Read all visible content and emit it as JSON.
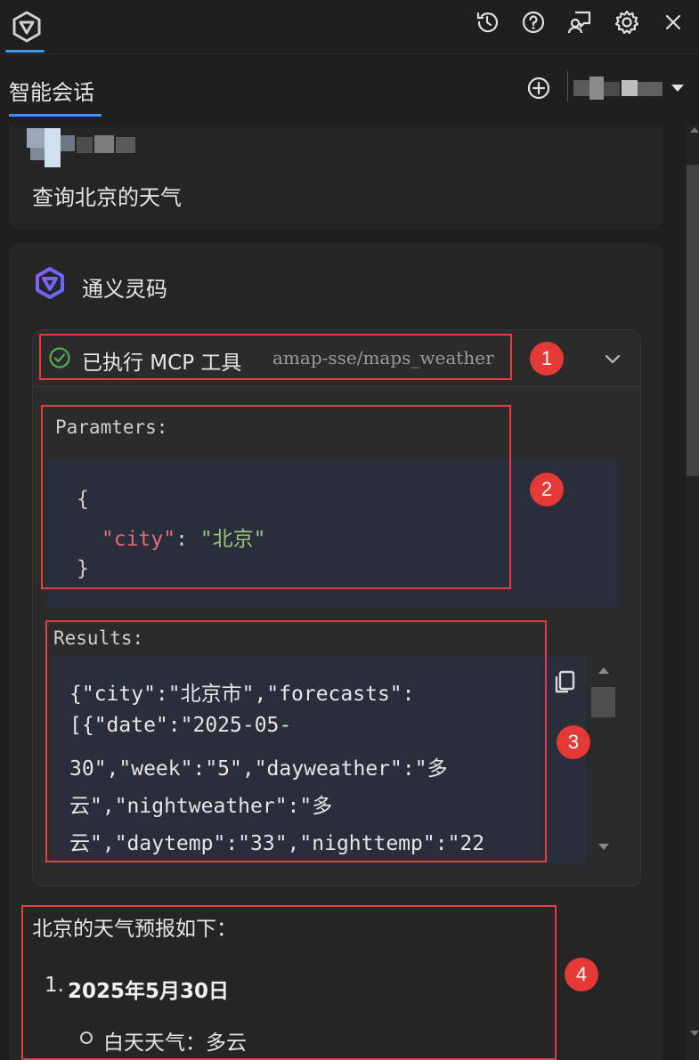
{
  "topbar": {
    "icons": [
      "history-icon",
      "help-icon",
      "feedback-icon",
      "settings-icon",
      "close-icon"
    ]
  },
  "tabs": {
    "active_label": "智能会话"
  },
  "user_message": {
    "text": "查询北京的天气"
  },
  "assistant": {
    "name": "通义灵码",
    "tool_call": {
      "status_label": "已执行 MCP 工具",
      "tool_name": "amap-sse/maps_weather",
      "params_label": "Paramters:",
      "params_open": "{",
      "params_key": "\"city\"",
      "params_colon": ": ",
      "params_value": "\"北京\"",
      "params_close": "}",
      "results_label": "Results:",
      "results_lines": [
        "{\"city\":\"北京市\",\"forecasts\":",
        "[{\"date\":\"2025-05-",
        "30\",\"week\":\"5\",\"dayweather\":\"多",
        "云\",\"nightweather\":\"多",
        "云\",\"daytemp\":\"33\",\"nighttemp\":\"22"
      ]
    },
    "answer": {
      "intro": "北京的天气预报如下：",
      "item_number": "1.",
      "item_title": "2025年5月30日",
      "sub_item": "白天天气：多云"
    }
  },
  "annotations": [
    "1",
    "2",
    "3",
    "4"
  ],
  "colors": {
    "accent": "#3794ff",
    "annotation_red": "#e53935",
    "success_green": "#4caf50",
    "code_key": "#e06c75",
    "code_string": "#98c379"
  }
}
